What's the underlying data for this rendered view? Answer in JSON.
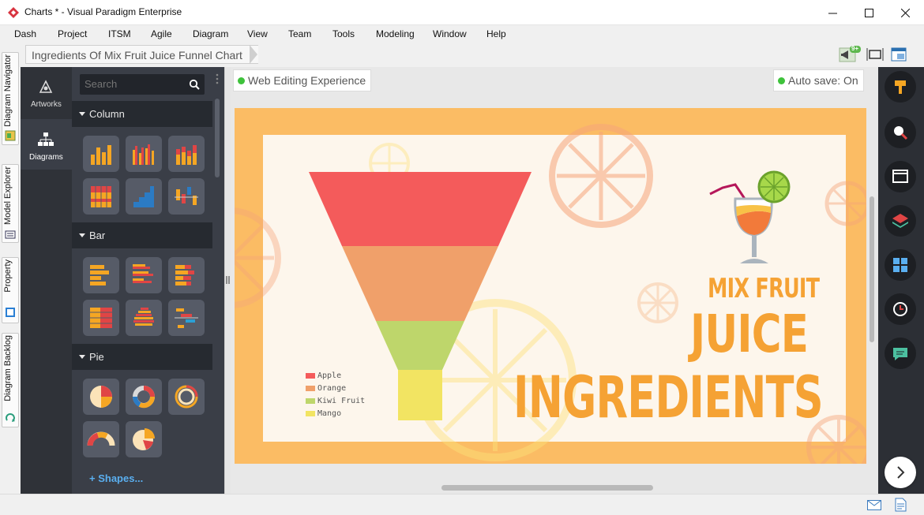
{
  "window": {
    "title": "Charts * - Visual Paradigm Enterprise",
    "controls": [
      "minimize-icon",
      "maximize-icon",
      "close-icon"
    ]
  },
  "menu": [
    "Dash",
    "Project",
    "ITSM",
    "Agile",
    "Diagram",
    "View",
    "Team",
    "Tools",
    "Modeling",
    "Window",
    "Help"
  ],
  "left_tabs": [
    "Diagram Navigator",
    "Model Explorer",
    "Property",
    "Diagram Backlog"
  ],
  "breadcrumb": "Ingredients Of Mix Fruit Juice Funnel Chart",
  "notifications_badge": "9+",
  "categories": {
    "artworks": "Artworks",
    "diagrams": "Diagrams"
  },
  "gallery": {
    "search_placeholder": "Search",
    "sections": [
      "Column",
      "Bar",
      "Pie"
    ],
    "shapes_link": "+ Shapes..."
  },
  "canvas": {
    "web_editing": "Web Editing Experience",
    "auto_save": "Auto save: On"
  },
  "chart_data": {
    "type": "funnel",
    "title": [
      "MIX FRUIT",
      "JUICE",
      "INGREDIENTS"
    ],
    "categories": [
      "Apple",
      "Orange",
      "Kiwi Fruit",
      "Mango"
    ],
    "colors": [
      "#f45b5b",
      "#f0a06a",
      "#bed66b",
      "#f2e462"
    ],
    "legend_position": "bottom-left"
  },
  "right_tools": [
    "format-painter-icon",
    "zoom-icon",
    "window-icon",
    "layers-icon",
    "grid-icon",
    "history-icon",
    "comment-icon"
  ],
  "status_icons": [
    "mail-icon",
    "document-icon"
  ],
  "colors": {
    "accent": "#f5a234",
    "frame": "#fbbc64",
    "panel_dark": "#3a3e47"
  }
}
